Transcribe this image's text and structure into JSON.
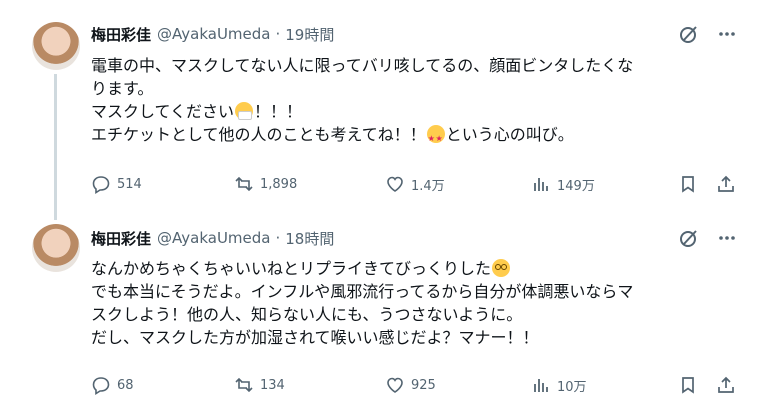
{
  "tweets": [
    {
      "name": "梅田彩佳",
      "handle": "@AyakaUmeda",
      "time": "19時間",
      "lines": [
        "電車の中、マスクしてない人に限ってバリ咳してるの、顔面ビンタしたくな",
        "ります。",
        "マスクしてください",
        "！！！",
        "エチケットとして他の人のことも考えてね！！",
        "という心の叫び。"
      ],
      "emojis": [
        "face-with-medical-mask",
        "star-struck"
      ],
      "stats": {
        "replies": "514",
        "reposts": "1,898",
        "likes": "1.4万",
        "views": "149万"
      }
    },
    {
      "name": "梅田彩佳",
      "handle": "@AyakaUmeda",
      "time": "18時間",
      "lines": [
        "なんかめちゃくちゃいいねとリプライきてびっくりした",
        "でも本当にそうだよ。インフルや風邪流行ってるから自分が体調悪いならマ",
        "スクしよう！他の人、知らない人にも、うつさないように。",
        "だし、マスクした方が加湿されて喉いい感じだよ？マナー！！"
      ],
      "emojis": [
        "flushed-face"
      ],
      "stats": {
        "replies": "68",
        "reposts": "134",
        "likes": "925",
        "views": "10万"
      }
    }
  ],
  "colors": {
    "text": "#0f1419",
    "secondary": "#536471",
    "thread_line": "#cfd9de"
  }
}
